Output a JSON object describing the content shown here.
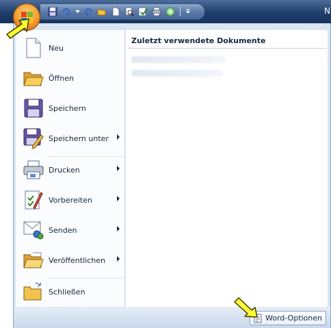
{
  "title_bar": {
    "right_text": "N"
  },
  "menu": {
    "items": [
      {
        "label": "Neu",
        "has_submenu": false,
        "icon": "new-document-icon"
      },
      {
        "label": "Öffnen",
        "has_submenu": false,
        "icon": "open-folder-icon"
      },
      {
        "label": "Speichern",
        "has_submenu": false,
        "icon": "save-floppy-icon"
      },
      {
        "label": "Speichern unter",
        "has_submenu": true,
        "icon": "save-as-icon"
      },
      {
        "label": "Drucken",
        "has_submenu": true,
        "icon": "printer-icon"
      },
      {
        "label": "Vorbereiten",
        "has_submenu": true,
        "icon": "prepare-document-icon"
      },
      {
        "label": "Senden",
        "has_submenu": true,
        "icon": "send-icon"
      },
      {
        "label": "Veröffentlichen",
        "has_submenu": true,
        "icon": "publish-folder-icon"
      },
      {
        "label": "Schließen",
        "has_submenu": false,
        "icon": "close-folder-icon"
      }
    ]
  },
  "recent": {
    "title": "Zuletzt verwendete Dokumente"
  },
  "bottom": {
    "options_label": "Word-Optionen"
  },
  "colors": {
    "title_bar": "#1f3d6b",
    "menu_frame": "#dbe5f2",
    "office_button": "#f39a2b",
    "pointer_arrow": "#ffff33"
  }
}
